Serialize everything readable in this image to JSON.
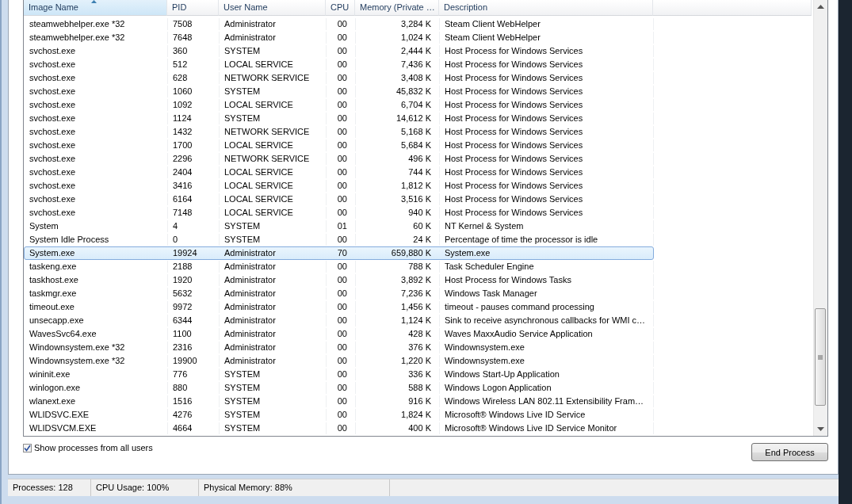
{
  "table": {
    "columns": [
      "Image Name",
      "PID",
      "User Name",
      "CPU",
      "Memory (Private …",
      "Description"
    ],
    "rows": [
      {
        "image_name": "steamwebhelper.exe *32",
        "pid": "7508",
        "user_name": "Administrator",
        "cpu": "00",
        "memory": "3,284 K",
        "description": "Steam Client WebHelper",
        "selected": false
      },
      {
        "image_name": "steamwebhelper.exe *32",
        "pid": "7648",
        "user_name": "Administrator",
        "cpu": "00",
        "memory": "1,024 K",
        "description": "Steam Client WebHelper",
        "selected": false
      },
      {
        "image_name": "svchost.exe",
        "pid": "360",
        "user_name": "SYSTEM",
        "cpu": "00",
        "memory": "2,444 K",
        "description": "Host Process for Windows Services",
        "selected": false
      },
      {
        "image_name": "svchost.exe",
        "pid": "512",
        "user_name": "LOCAL SERVICE",
        "cpu": "00",
        "memory": "7,436 K",
        "description": "Host Process for Windows Services",
        "selected": false
      },
      {
        "image_name": "svchost.exe",
        "pid": "628",
        "user_name": "NETWORK SERVICE",
        "cpu": "00",
        "memory": "3,408 K",
        "description": "Host Process for Windows Services",
        "selected": false
      },
      {
        "image_name": "svchost.exe",
        "pid": "1060",
        "user_name": "SYSTEM",
        "cpu": "00",
        "memory": "45,832 K",
        "description": "Host Process for Windows Services",
        "selected": false
      },
      {
        "image_name": "svchost.exe",
        "pid": "1092",
        "user_name": "LOCAL SERVICE",
        "cpu": "00",
        "memory": "6,704 K",
        "description": "Host Process for Windows Services",
        "selected": false
      },
      {
        "image_name": "svchost.exe",
        "pid": "1124",
        "user_name": "SYSTEM",
        "cpu": "00",
        "memory": "14,612 K",
        "description": "Host Process for Windows Services",
        "selected": false
      },
      {
        "image_name": "svchost.exe",
        "pid": "1432",
        "user_name": "NETWORK SERVICE",
        "cpu": "00",
        "memory": "5,168 K",
        "description": "Host Process for Windows Services",
        "selected": false
      },
      {
        "image_name": "svchost.exe",
        "pid": "1700",
        "user_name": "LOCAL SERVICE",
        "cpu": "00",
        "memory": "5,684 K",
        "description": "Host Process for Windows Services",
        "selected": false
      },
      {
        "image_name": "svchost.exe",
        "pid": "2296",
        "user_name": "NETWORK SERVICE",
        "cpu": "00",
        "memory": "496 K",
        "description": "Host Process for Windows Services",
        "selected": false
      },
      {
        "image_name": "svchost.exe",
        "pid": "2404",
        "user_name": "LOCAL SERVICE",
        "cpu": "00",
        "memory": "744 K",
        "description": "Host Process for Windows Services",
        "selected": false
      },
      {
        "image_name": "svchost.exe",
        "pid": "3416",
        "user_name": "LOCAL SERVICE",
        "cpu": "00",
        "memory": "1,812 K",
        "description": "Host Process for Windows Services",
        "selected": false
      },
      {
        "image_name": "svchost.exe",
        "pid": "6164",
        "user_name": "LOCAL SERVICE",
        "cpu": "00",
        "memory": "3,516 K",
        "description": "Host Process for Windows Services",
        "selected": false
      },
      {
        "image_name": "svchost.exe",
        "pid": "7148",
        "user_name": "LOCAL SERVICE",
        "cpu": "00",
        "memory": "940 K",
        "description": "Host Process for Windows Services",
        "selected": false
      },
      {
        "image_name": "System",
        "pid": "4",
        "user_name": "SYSTEM",
        "cpu": "01",
        "memory": "60 K",
        "description": "NT Kernel & System",
        "selected": false
      },
      {
        "image_name": "System Idle Process",
        "pid": "0",
        "user_name": "SYSTEM",
        "cpu": "00",
        "memory": "24 K",
        "description": "Percentage of time the processor is idle",
        "selected": false
      },
      {
        "image_name": "System.exe",
        "pid": "19924",
        "user_name": "Administrator",
        "cpu": "70",
        "memory": "659,880 K",
        "description": "System.exe",
        "selected": true
      },
      {
        "image_name": "taskeng.exe",
        "pid": "2188",
        "user_name": "Administrator",
        "cpu": "00",
        "memory": "788 K",
        "description": "Task Scheduler Engine",
        "selected": false
      },
      {
        "image_name": "taskhost.exe",
        "pid": "1920",
        "user_name": "Administrator",
        "cpu": "00",
        "memory": "3,892 K",
        "description": "Host Process for Windows Tasks",
        "selected": false
      },
      {
        "image_name": "taskmgr.exe",
        "pid": "5632",
        "user_name": "Administrator",
        "cpu": "00",
        "memory": "7,236 K",
        "description": "Windows Task Manager",
        "selected": false
      },
      {
        "image_name": "timeout.exe",
        "pid": "9972",
        "user_name": "Administrator",
        "cpu": "00",
        "memory": "1,456 K",
        "description": "timeout - pauses command processing",
        "selected": false
      },
      {
        "image_name": "unsecapp.exe",
        "pid": "6344",
        "user_name": "Administrator",
        "cpu": "00",
        "memory": "1,124 K",
        "description": "Sink to receive asynchronous callbacks for WMI c…",
        "selected": false
      },
      {
        "image_name": "WavesSvc64.exe",
        "pid": "1100",
        "user_name": "Administrator",
        "cpu": "00",
        "memory": "428 K",
        "description": "Waves MaxxAudio Service Application",
        "selected": false
      },
      {
        "image_name": "Windownsystem.exe *32",
        "pid": "2316",
        "user_name": "Administrator",
        "cpu": "00",
        "memory": "376 K",
        "description": "Windownsystem.exe",
        "selected": false
      },
      {
        "image_name": "Windownsystem.exe *32",
        "pid": "19900",
        "user_name": "Administrator",
        "cpu": "00",
        "memory": "1,220 K",
        "description": "Windownsystem.exe",
        "selected": false
      },
      {
        "image_name": "wininit.exe",
        "pid": "776",
        "user_name": "SYSTEM",
        "cpu": "00",
        "memory": "336 K",
        "description": "Windows Start-Up Application",
        "selected": false
      },
      {
        "image_name": "winlogon.exe",
        "pid": "880",
        "user_name": "SYSTEM",
        "cpu": "00",
        "memory": "588 K",
        "description": "Windows Logon Application",
        "selected": false
      },
      {
        "image_name": "wlanext.exe",
        "pid": "1516",
        "user_name": "SYSTEM",
        "cpu": "00",
        "memory": "916 K",
        "description": "Windows Wireless LAN 802.11 Extensibility Fram…",
        "selected": false
      },
      {
        "image_name": "WLIDSVC.EXE",
        "pid": "4276",
        "user_name": "SYSTEM",
        "cpu": "00",
        "memory": "1,824 K",
        "description": "Microsoft® Windows Live ID Service",
        "selected": false
      },
      {
        "image_name": "WLIDSVCM.EXE",
        "pid": "4664",
        "user_name": "SYSTEM",
        "cpu": "00",
        "memory": "400 K",
        "description": "Microsoft® Windows Live ID Service Monitor",
        "selected": false
      }
    ]
  },
  "show_all_users": {
    "label": "Show processes from all users",
    "checked": true
  },
  "end_process_button": "End Process",
  "status_bar": [
    "Processes: 128",
    "CPU Usage: 100%",
    "Physical Memory: 88%"
  ]
}
